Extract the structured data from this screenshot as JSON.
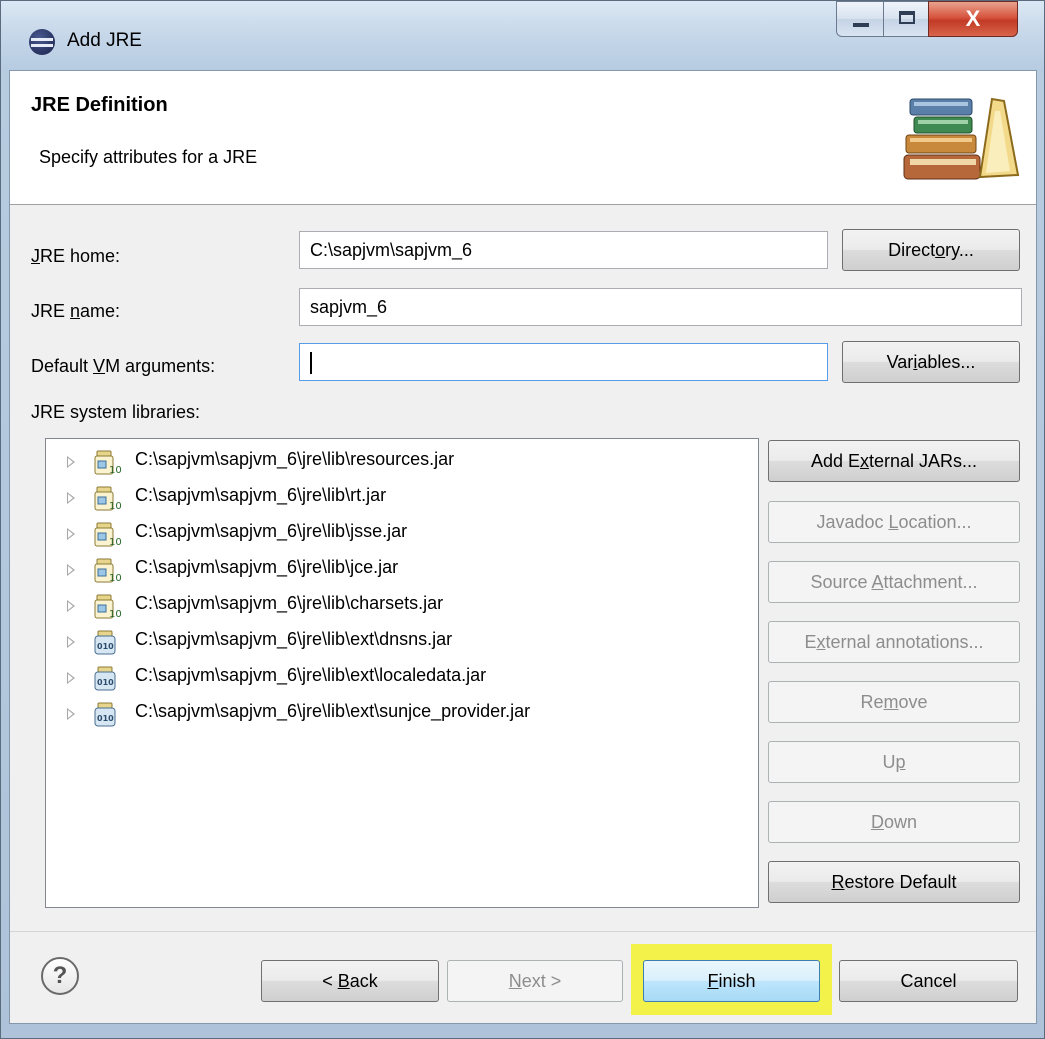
{
  "window": {
    "title": "Add JRE",
    "controls": {
      "minimize": "minimize",
      "maximize": "maximize",
      "close": "X"
    }
  },
  "banner": {
    "title": "JRE Definition",
    "subtitle": "Specify attributes for a JRE",
    "icon": "library-books-icon"
  },
  "form": {
    "jre_home": {
      "label_pre": "",
      "label_ul": "J",
      "label_post": "RE home:",
      "value": "C:\\sapjvm\\sapjvm_6"
    },
    "jre_name": {
      "label_pre": "JRE ",
      "label_ul": "n",
      "label_post": "ame:",
      "value": "sapjvm_6"
    },
    "vm_args": {
      "label_pre": "Default ",
      "label_ul": "V",
      "label_post": "M arguments:",
      "value": ""
    },
    "directory_button": {
      "pre": "Direct",
      "ul": "o",
      "post": "ry..."
    },
    "variables_button": {
      "pre": "Var",
      "ul": "i",
      "post": "ables..."
    },
    "libraries_label": "JRE system libraries:"
  },
  "libraries": [
    {
      "path": "C:\\sapjvm\\sapjvm_6\\jre\\lib\\resources.jar",
      "icon": "jar-source-icon"
    },
    {
      "path": "C:\\sapjvm\\sapjvm_6\\jre\\lib\\rt.jar",
      "icon": "jar-source-icon"
    },
    {
      "path": "C:\\sapjvm\\sapjvm_6\\jre\\lib\\jsse.jar",
      "icon": "jar-source-icon"
    },
    {
      "path": "C:\\sapjvm\\sapjvm_6\\jre\\lib\\jce.jar",
      "icon": "jar-source-icon"
    },
    {
      "path": "C:\\sapjvm\\sapjvm_6\\jre\\lib\\charsets.jar",
      "icon": "jar-source-icon"
    },
    {
      "path": "C:\\sapjvm\\sapjvm_6\\jre\\lib\\ext\\dnsns.jar",
      "icon": "jar-binary-icon"
    },
    {
      "path": "C:\\sapjvm\\sapjvm_6\\jre\\lib\\ext\\localedata.jar",
      "icon": "jar-binary-icon"
    },
    {
      "path": "C:\\sapjvm\\sapjvm_6\\jre\\lib\\ext\\sunjce_provider.jar",
      "icon": "jar-binary-icon"
    }
  ],
  "side_buttons": {
    "add_external": {
      "pre": "Add E",
      "ul": "x",
      "post": "ternal JARs..."
    },
    "javadoc": {
      "pre": "Javadoc ",
      "ul": "L",
      "post": "ocation..."
    },
    "source": {
      "pre": "Source ",
      "ul": "A",
      "post": "ttachment..."
    },
    "external_annotations": {
      "pre": "E",
      "ul": "x",
      "post": "ternal annotations..."
    },
    "remove": {
      "pre": "Re",
      "ul": "m",
      "post": "ove"
    },
    "up": {
      "pre": "U",
      "ul": "p",
      "post": ""
    },
    "down": {
      "pre": "",
      "ul": "D",
      "post": "own"
    },
    "restore": {
      "pre": "",
      "ul": "R",
      "post": "estore Default"
    }
  },
  "footer": {
    "help": "?",
    "back": {
      "pre": "< ",
      "ul": "B",
      "post": "ack"
    },
    "next": {
      "pre": "",
      "ul": "N",
      "post": "ext >"
    },
    "finish": {
      "pre": "",
      "ul": "F",
      "post": "inish"
    },
    "cancel": "Cancel"
  },
  "colors": {
    "highlight": "#f3f24a",
    "focus_border": "#569de5"
  }
}
